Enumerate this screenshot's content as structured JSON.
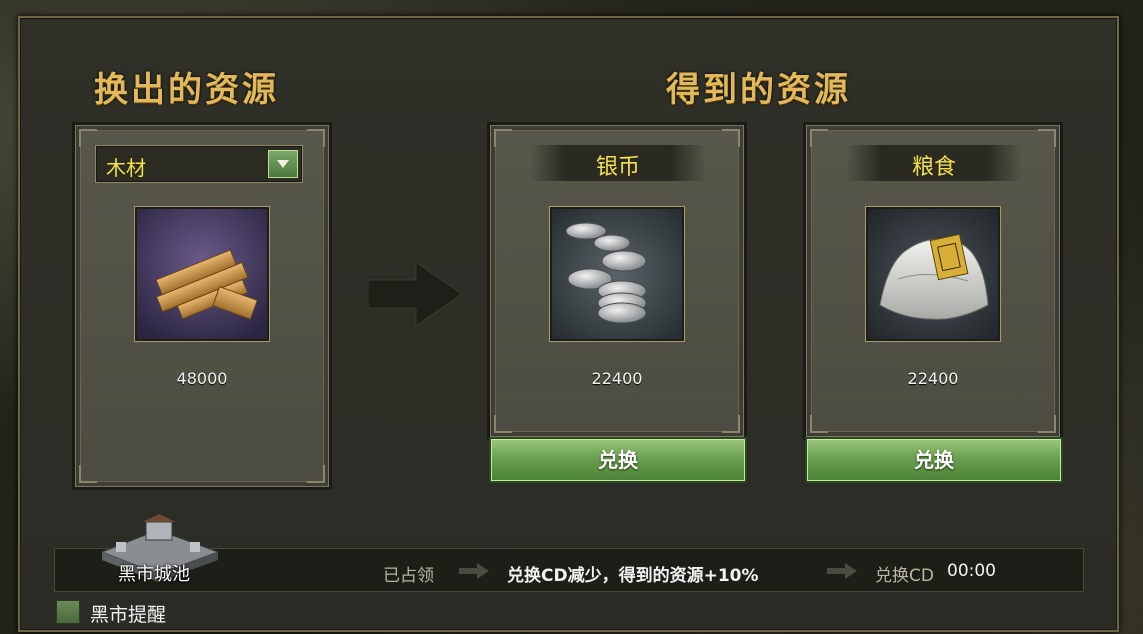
{
  "left_section": {
    "title": "换出的资源",
    "dropdown_value": "木材",
    "amount": "48000",
    "icon": "wood-planks-icon"
  },
  "right_section": {
    "title": "得到的资源",
    "resources": [
      {
        "name": "银币",
        "amount": "22400",
        "icon": "silver-coins-icon",
        "button": "兑换"
      },
      {
        "name": "粮食",
        "amount": "22400",
        "icon": "grain-sack-icon",
        "button": "兑换"
      }
    ]
  },
  "status": {
    "city_label": "黑市城池",
    "occupied": "已占领",
    "bonus": "兑换CD减少，得到的资源+10%",
    "cd_label": "兑换CD",
    "cd_time": "00:00"
  },
  "reminder": {
    "label": "黑市提醒"
  },
  "colors": {
    "title_gold": "#e2b95a",
    "resource_yellow": "#f4e04a",
    "button_green": "#6aa04e"
  }
}
